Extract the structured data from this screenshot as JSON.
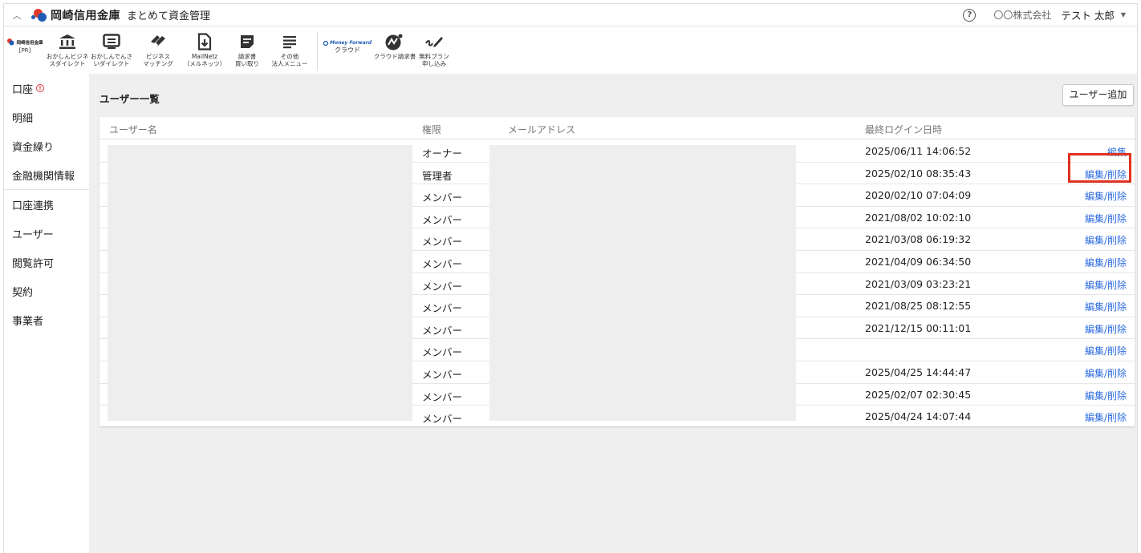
{
  "app": {
    "brand": "岡崎信用金庫",
    "subtitle": "まとめて資金管理",
    "company": "〇〇株式会社",
    "user": "テスト 太郎"
  },
  "toolbar": {
    "pr_name": "岡崎信用金庫",
    "pr_tag": "[PR]",
    "items": [
      {
        "label": "おかしんビジネ\nスダイレクト",
        "icon": "bank-icon"
      },
      {
        "label": "おかしんでんさ\nいダイレクト",
        "icon": "monitor-icon"
      },
      {
        "label": "ビジネス\nマッチング",
        "icon": "handshake-icon"
      },
      {
        "label": "MailNetz\n（メルネッツ）",
        "icon": "document-download-icon"
      },
      {
        "label": "請求書\n買い取り",
        "icon": "invoice-icon"
      },
      {
        "label": "その他\n法人メニュー",
        "icon": "menu-icon"
      }
    ],
    "mf_brand": "Money Forward",
    "mf_cloud": "クラウド",
    "mf_invoice": "クラウド請求書",
    "free_plan": "無料プラン\n申し込み"
  },
  "sidebar": {
    "items": [
      {
        "label": "口座",
        "alert": true
      },
      {
        "label": "明細"
      },
      {
        "label": "資金繰り"
      },
      {
        "label": "金融機関情報"
      },
      {
        "label": "口座連携"
      },
      {
        "label": "ユーザー"
      },
      {
        "label": "閲覧許可"
      },
      {
        "label": "契約"
      },
      {
        "label": "事業者"
      }
    ]
  },
  "main": {
    "title": "ユーザー一覧",
    "add_button": "ユーザー追加",
    "columns": {
      "name": "ユーザー名",
      "role": "権限",
      "email": "メールアドレス",
      "last_login": "最終ログイン日時"
    },
    "rows": [
      {
        "role": "オーナー",
        "last_login": "2025/06/11 14:06:52",
        "action": "編集"
      },
      {
        "role": "管理者",
        "last_login": "2025/02/10 08:35:43",
        "action": "編集/削除"
      },
      {
        "role": "メンバー",
        "last_login": "2020/02/10 07:04:09",
        "action": "編集/削除"
      },
      {
        "role": "メンバー",
        "last_login": "2021/08/02 10:02:10",
        "action": "編集/削除"
      },
      {
        "role": "メンバー",
        "last_login": "2021/03/08 06:19:32",
        "action": "編集/削除"
      },
      {
        "role": "メンバー",
        "last_login": "2021/04/09 06:34:50",
        "action": "編集/削除"
      },
      {
        "role": "メンバー",
        "last_login": "2021/03/09 03:23:21",
        "action": "編集/削除"
      },
      {
        "role": "メンバー",
        "last_login": "2021/08/25 08:12:55",
        "action": "編集/削除"
      },
      {
        "role": "メンバー",
        "last_login": "2021/12/15 00:11:01",
        "action": "編集/削除"
      },
      {
        "role": "メンバー",
        "last_login": "",
        "action": "編集/削除"
      },
      {
        "role": "メンバー",
        "last_login": "2025/04/25 14:44:47",
        "action": "編集/削除"
      },
      {
        "role": "メンバー",
        "last_login": "2025/02/07 02:30:45",
        "action": "編集/削除"
      },
      {
        "role": "メンバー",
        "last_login": "2025/04/24 14:07:44",
        "action": "編集/削除"
      }
    ]
  },
  "colors": {
    "link": "#2d6cdf",
    "highlight": "#e0321f",
    "alert": "#dd3333"
  }
}
